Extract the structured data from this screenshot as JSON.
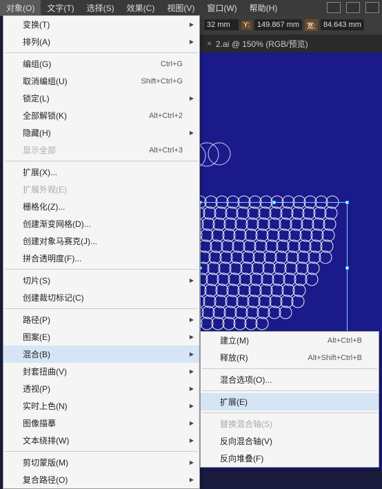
{
  "menubar": {
    "items": [
      {
        "label": "对象(O)",
        "active": true
      },
      {
        "label": "文字(T)"
      },
      {
        "label": "选择(S)"
      },
      {
        "label": "效果(C)"
      },
      {
        "label": "视图(V)"
      },
      {
        "label": "窗口(W)"
      },
      {
        "label": "帮助(H)"
      }
    ]
  },
  "coord": {
    "x_unit": "32 mm",
    "y_label": "Y:",
    "y_val": "149.867",
    "w_label": "宽:",
    "w_val": "84.643",
    "unit": "mm"
  },
  "tab": {
    "close": "×",
    "title": "2.ai @ 150% (RGB/预览)"
  },
  "dropdown": {
    "g1": [
      {
        "label": "变换(T)",
        "sub": true
      },
      {
        "label": "排列(A)",
        "sub": true
      }
    ],
    "g2": [
      {
        "label": "编组(G)",
        "short": "Ctrl+G"
      },
      {
        "label": "取消编组(U)",
        "short": "Shift+Ctrl+G"
      },
      {
        "label": "锁定(L)",
        "sub": true
      },
      {
        "label": "全部解锁(K)",
        "short": "Alt+Ctrl+2"
      },
      {
        "label": "隐藏(H)",
        "sub": true
      },
      {
        "label": "显示全部",
        "short": "Alt+Ctrl+3",
        "disabled": true
      }
    ],
    "g3": [
      {
        "label": "扩展(X)..."
      },
      {
        "label": "扩展外观(E)",
        "disabled": true
      },
      {
        "label": "栅格化(Z)..."
      },
      {
        "label": "创建渐变网格(D)..."
      },
      {
        "label": "创建对象马赛克(J)..."
      },
      {
        "label": "拼合透明度(F)..."
      }
    ],
    "g4": [
      {
        "label": "切片(S)",
        "sub": true
      },
      {
        "label": "创建裁切标记(C)"
      }
    ],
    "g5": [
      {
        "label": "路径(P)",
        "sub": true
      },
      {
        "label": "图案(E)",
        "sub": true
      },
      {
        "label": "混合(B)",
        "sub": true,
        "hover": true
      },
      {
        "label": "封套扭曲(V)",
        "sub": true
      },
      {
        "label": "透视(P)",
        "sub": true
      },
      {
        "label": "实时上色(N)",
        "sub": true
      },
      {
        "label": "图像描摹",
        "sub": true
      },
      {
        "label": "文本绕排(W)",
        "sub": true
      }
    ],
    "g6": [
      {
        "label": "剪切蒙版(M)",
        "sub": true
      },
      {
        "label": "复合路径(O)",
        "sub": true
      }
    ]
  },
  "submenu": {
    "items": [
      {
        "label": "建立(M)",
        "short": "Alt+Ctrl+B"
      },
      {
        "label": "释放(R)",
        "short": "Alt+Shift+Ctrl+B"
      },
      {
        "sep": true
      },
      {
        "label": "混合选项(O)..."
      },
      {
        "sep": true
      },
      {
        "label": "扩展(E)",
        "hover": true
      },
      {
        "sep": true
      },
      {
        "label": "替换混合轴(S)",
        "disabled": true
      },
      {
        "label": "反向混合轴(V)"
      },
      {
        "label": "反向堆叠(F)"
      }
    ]
  }
}
